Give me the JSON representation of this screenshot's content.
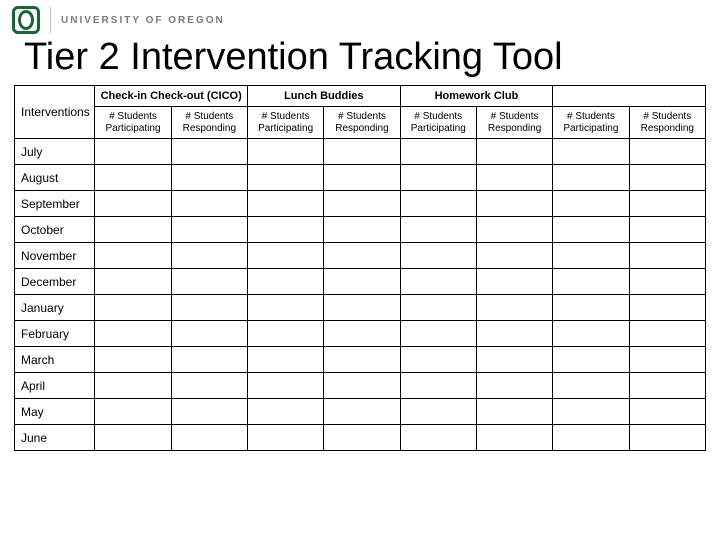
{
  "header": {
    "university": "UNIVERSITY OF OREGON"
  },
  "title": "Tier 2 Intervention Tracking Tool",
  "table": {
    "rowHeader": "Interventions",
    "groups": [
      {
        "label": "Check-in Check-out (CICO)"
      },
      {
        "label": "Lunch Buddies"
      },
      {
        "label": "Homework Club"
      },
      {
        "label": ""
      }
    ],
    "subheaders": {
      "participating": "# Students Participating",
      "responding": "# Students Responding"
    },
    "months": [
      "July",
      "August",
      "September",
      "October",
      "November",
      "December",
      "January",
      "February",
      "March",
      "April",
      "May",
      "June"
    ]
  }
}
